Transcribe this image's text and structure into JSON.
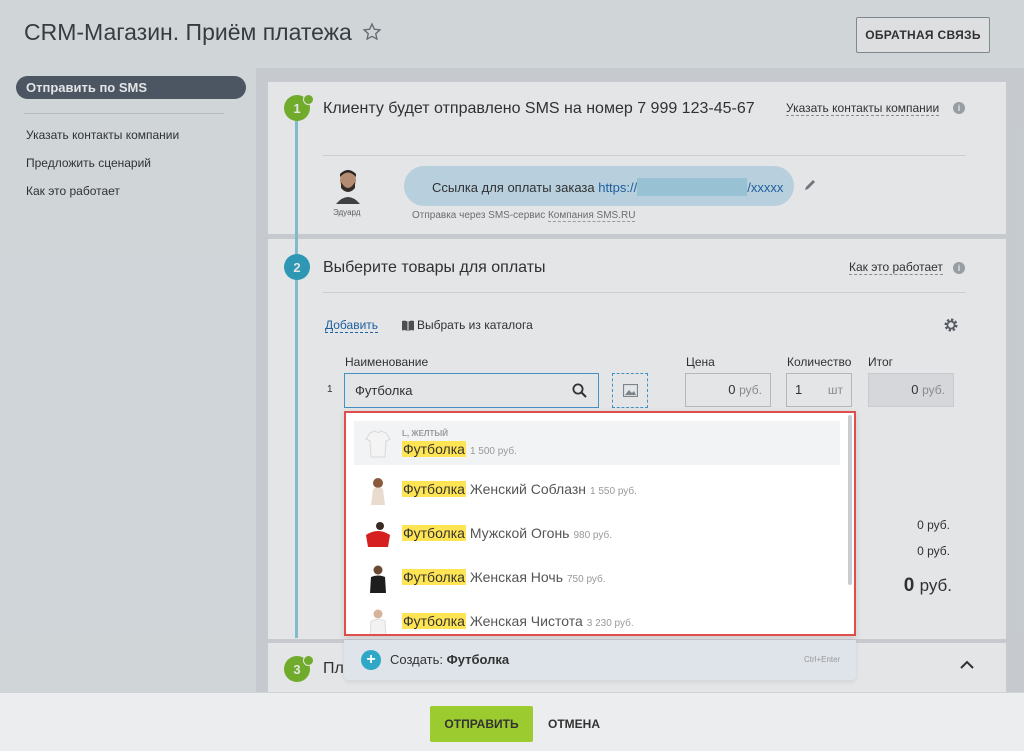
{
  "header": {
    "title": "CRM-Магазин. Приём платежа",
    "feedback_label": "ОБРАТНАЯ СВЯЗЬ"
  },
  "sidebar": {
    "active_item": "Отправить по SMS",
    "items": [
      {
        "label": "Указать контакты компании"
      },
      {
        "label": "Предложить сценарий"
      },
      {
        "label": "Как это работает"
      }
    ]
  },
  "step1": {
    "number": "1",
    "title": "Клиенту будет отправлено SMS на номер 7 999 123-45-67",
    "help_link": "Указать контакты компании",
    "sender_name": "Эдуард",
    "message_prefix": "Ссылка для оплаты заказа ",
    "link_start": "https://",
    "link_end": "/xxxxx",
    "sms_note_prefix": "Отправка через SMS-сервис ",
    "sms_note_link": "Компания SMS.RU"
  },
  "step2": {
    "number": "2",
    "title": "Выберите товары для оплаты",
    "help_link": "Как это работает",
    "add_link": "Добавить",
    "catalog_link": "Выбрать из каталога",
    "columns": {
      "name": "Наименование",
      "price": "Цена",
      "quantity": "Количество",
      "total": "Итог"
    },
    "row": {
      "index": "1",
      "name_value": "Футболка",
      "price_value": "0",
      "price_unit": "руб.",
      "qty_value": "1",
      "qty_unit": "шт",
      "total_value": "0",
      "total_unit": "руб."
    },
    "summary": {
      "line1": "0 руб.",
      "line2": "0 руб.",
      "total_value": "0",
      "total_unit": "руб."
    }
  },
  "dropdown": {
    "items": [
      {
        "sub": "L, ЖЕЛТЫЙ",
        "match": "Футболка",
        "rest": "",
        "price": "1 500 руб."
      },
      {
        "sub": "",
        "match": "Футболка",
        "rest": " Женский Соблазн",
        "price": "1 550 руб."
      },
      {
        "sub": "",
        "match": "Футболка",
        "rest": " Мужской Огонь",
        "price": "980 руб."
      },
      {
        "sub": "",
        "match": "Футболка",
        "rest": " Женская Ночь",
        "price": "750 руб."
      },
      {
        "sub": "",
        "match": "Футболка",
        "rest": " Женская Чистота",
        "price": "3 230 руб."
      }
    ],
    "create_prefix": "Создать: ",
    "create_value": "Футболка",
    "shortcut": "Ctrl+Enter"
  },
  "step3": {
    "number": "3",
    "title_visible": "Пл"
  },
  "footer": {
    "send_label": "ОТПРАВИТЬ",
    "cancel_label": "ОТМЕНА"
  },
  "colors": {
    "accent_green": "#7bbd2c",
    "accent_blue": "#2fa7c6",
    "highlight": "#ffe553",
    "dropdown_border": "#e14c4c",
    "send_button": "#9bcb2e"
  }
}
